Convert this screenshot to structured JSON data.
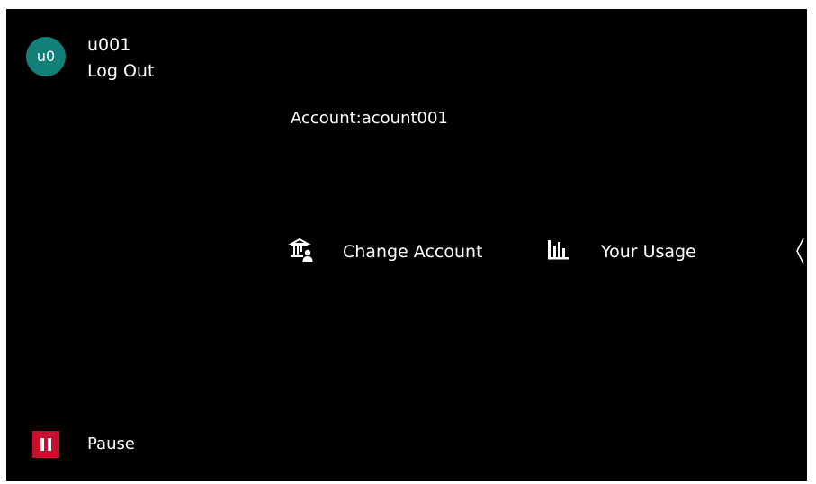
{
  "user": {
    "avatar_initials": "u0",
    "avatar_color": "#127f79",
    "name": "u001",
    "logout_label": "Log Out"
  },
  "account": {
    "label": "Account:acount001"
  },
  "actions": [
    {
      "label": "Change Account",
      "icon": "bank-user-icon"
    },
    {
      "label": "Your Usage",
      "icon": "bar-chart-icon"
    }
  ],
  "collapse": {
    "icon": "chevron-left-icon"
  },
  "pause": {
    "label": "Pause",
    "icon": "pause-icon",
    "color": "#c8102e"
  },
  "colors": {
    "background": "#000000",
    "text": "#ffffff"
  }
}
